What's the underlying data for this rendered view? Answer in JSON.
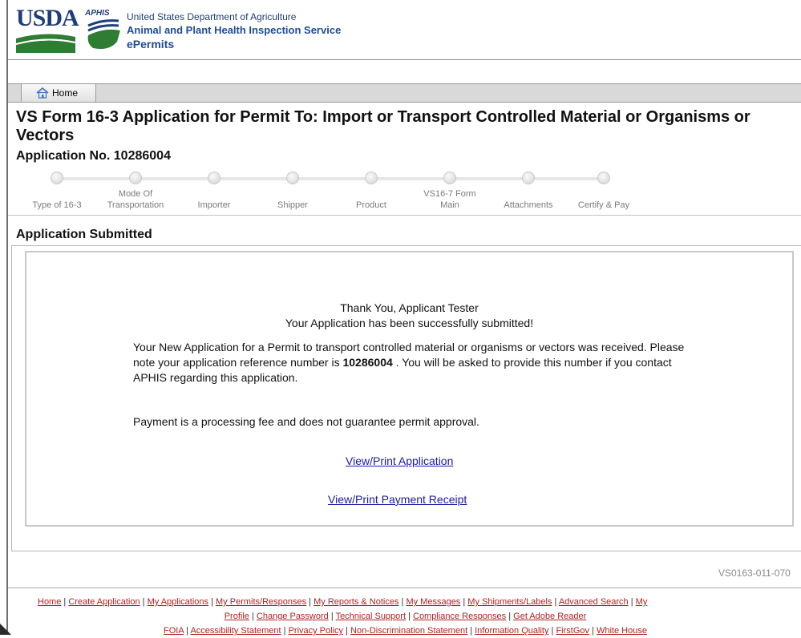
{
  "header": {
    "usda_label": "USDA",
    "aphis_label": "APHIS",
    "department": "United States Department of Agriculture",
    "agency": "Animal and Plant Health Inspection Service",
    "system": "ePermits"
  },
  "nav": {
    "home_label": "Home"
  },
  "page": {
    "title": "VS Form 16-3 Application for Permit To: Import or Transport Controlled Material or Organisms or Vectors",
    "application_number": "Application No. 10286004"
  },
  "steps": [
    {
      "line1": "",
      "line2": "Type of 16-3"
    },
    {
      "line1": "Mode Of",
      "line2": "Transportation"
    },
    {
      "line1": "",
      "line2": "Importer"
    },
    {
      "line1": "",
      "line2": "Shipper"
    },
    {
      "line1": "",
      "line2": "Product"
    },
    {
      "line1": "VS16-7 Form",
      "line2": "Main"
    },
    {
      "line1": "",
      "line2": "Attachments"
    },
    {
      "line1": "",
      "line2": "Certify & Pay"
    }
  ],
  "section": {
    "title": "Application Submitted",
    "thanks_line1": "Thank You, Applicant Tester",
    "thanks_line2": "Your Application has been successfully submitted!",
    "message_part1": "Your New Application for a Permit to transport controlled material or organisms or vectors was received. Please note your application reference number is ",
    "reference_number": "10286004",
    "message_part2": " . You will be asked to provide this number if you contact APHIS regarding this application.",
    "payment_note": "Payment is a processing fee and does not guarantee permit approval.",
    "view_application_link": "View/Print Application",
    "view_receipt_link": "View/Print Payment Receipt"
  },
  "footer": {
    "page_code": "VS0163-011-070",
    "row1": [
      "Home",
      "Create Application",
      "My Applications",
      "My Permits/Responses",
      "My Reports & Notices",
      "My Messages",
      "My Shipments/Labels",
      "Advanced Search",
      "My"
    ],
    "row2": [
      "Profile",
      "Change Password",
      "Technical Support",
      "Compliance Responses",
      "Get Adobe Reader"
    ],
    "row3": [
      "FOIA",
      "Accessibility Statement",
      "Privacy Policy",
      "Non-Discrimination Statement",
      "Information Quality",
      "FirstGov",
      "White House"
    ]
  },
  "colors": {
    "usda_blue": "#1f3d7a",
    "usda_green": "#2e7d32",
    "footer_link": "#b42020",
    "link_blue": "#1a1aa6"
  }
}
